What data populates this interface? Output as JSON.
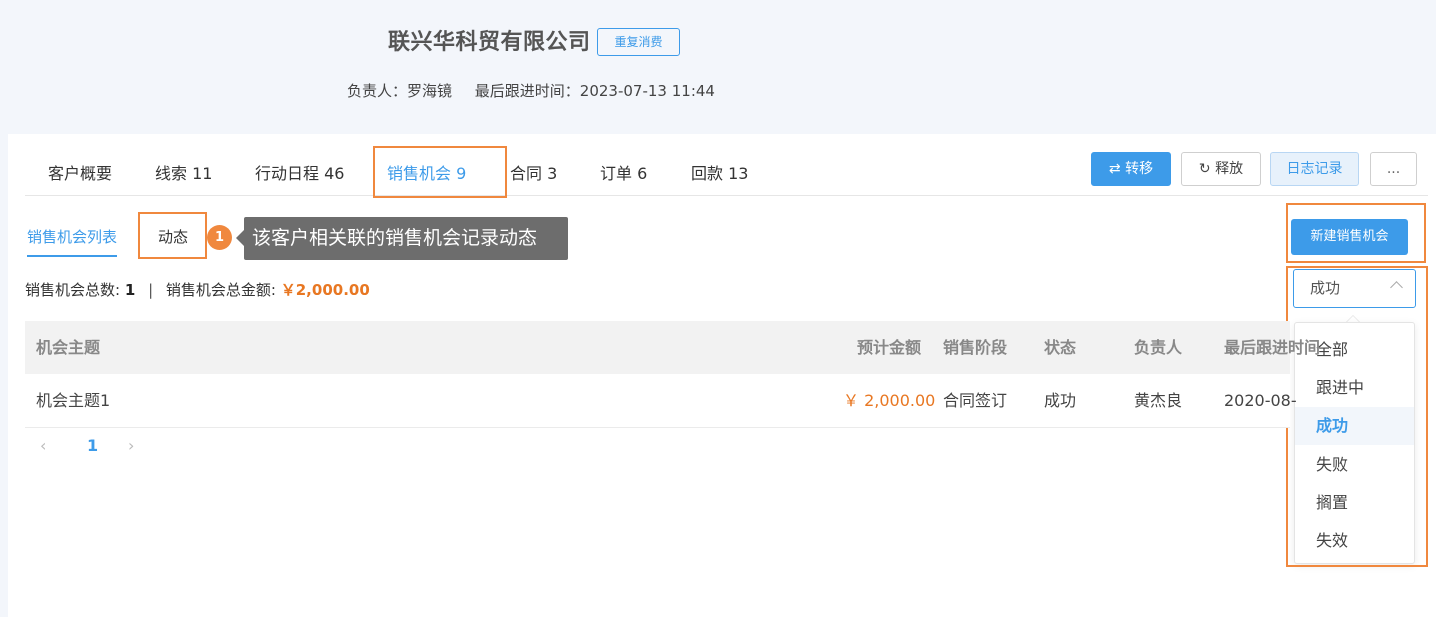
{
  "header": {
    "company_name": "联兴华科贸有限公司",
    "tag": "重复消费",
    "owner": "负责人：罗海镜",
    "last_follow": "最后跟进时间：2023-07-13 11:44"
  },
  "tabs": [
    {
      "label": "客户概要"
    },
    {
      "label": "线索 11"
    },
    {
      "label": "行动日程 46"
    },
    {
      "label": "销售机会 9"
    },
    {
      "label": "合同 3"
    },
    {
      "label": "订单 6"
    },
    {
      "label": "回款 13"
    }
  ],
  "toolbar": {
    "transfer": "⇄ 转移",
    "release": "↻ 释放",
    "log": "日志记录",
    "more": "..."
  },
  "subtabs": {
    "list": "销售机会列表",
    "dynamic": "动态"
  },
  "annotation": {
    "badge": "1",
    "tooltip": "该客户相关联的销售机会记录动态"
  },
  "new_button": "新建销售机会",
  "summary": {
    "count_label": "销售机会总数:",
    "count": "1",
    "separator": "|",
    "amount_label": "销售机会总金额:",
    "amount": "￥2,000.00"
  },
  "filter": {
    "selected": "成功",
    "options": [
      "全部",
      "跟进中",
      "成功",
      "失败",
      "搁置",
      "失效"
    ]
  },
  "table": {
    "columns": [
      "机会主题",
      "预计金额",
      "销售阶段",
      "状态",
      "负责人",
      "最后跟进时间"
    ],
    "rows": [
      [
        "机会主题1",
        "￥ 2,000.00",
        "合同签订",
        "成功",
        "黄杰良",
        "2020-08-"
      ]
    ]
  },
  "pager": {
    "prev": "‹",
    "current": "1",
    "next": "›"
  },
  "colors": {
    "accent": "#3d9be9",
    "highlight_box": "#f0883e",
    "amount": "#e87722"
  }
}
